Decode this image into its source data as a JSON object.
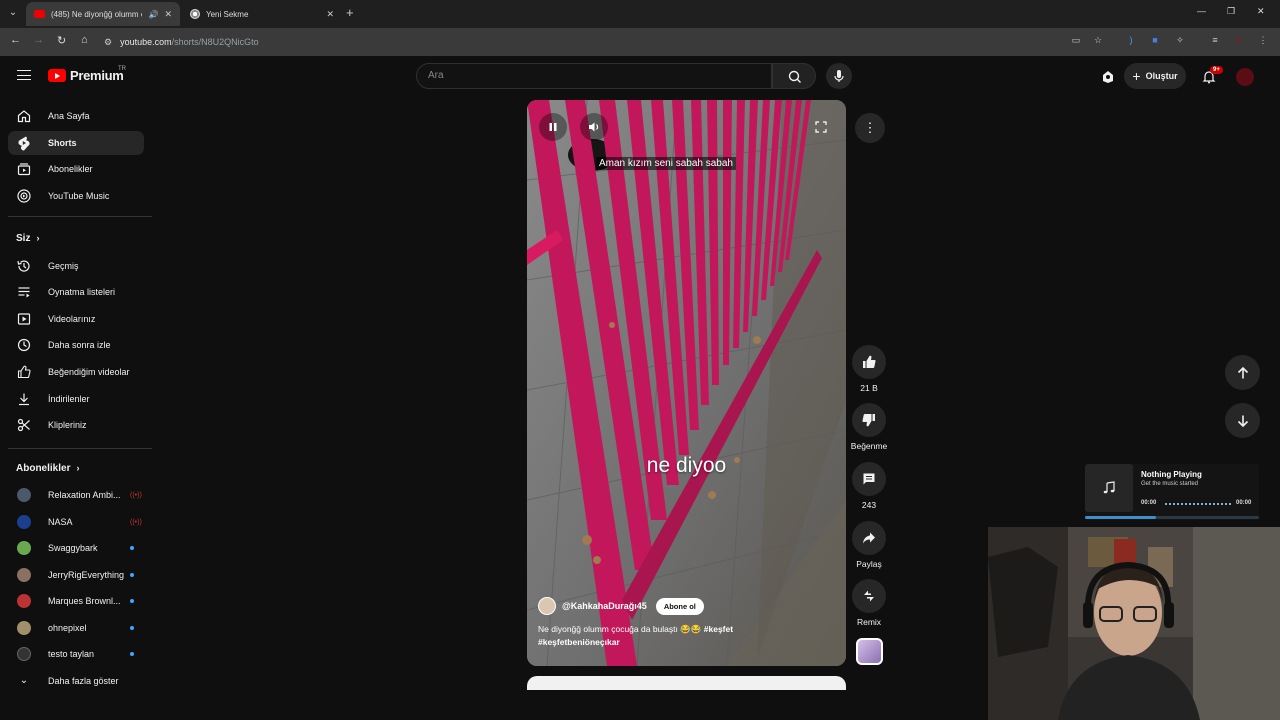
{
  "browser": {
    "tabs": [
      {
        "title": "(485) Ne diyonğğ olumm ç",
        "active": true
      },
      {
        "title": "Yeni Sekme",
        "active": false
      }
    ],
    "url_host": "youtube.com",
    "url_path": "/shorts/N8U2QNicGto"
  },
  "header": {
    "logo_text": "Premium",
    "region": "TR",
    "search_placeholder": "Ara",
    "create_label": "Oluştur",
    "notification_count": "9+"
  },
  "sidebar": {
    "main": [
      {
        "label": "Ana Sayfa",
        "icon": "home-icon"
      },
      {
        "label": "Shorts",
        "icon": "shorts-icon",
        "active": true
      },
      {
        "label": "Abonelikler",
        "icon": "subscriptions-icon"
      },
      {
        "label": "YouTube Music",
        "icon": "youtube-music-icon"
      }
    ],
    "you_heading": "Siz",
    "you": [
      {
        "label": "Geçmiş",
        "icon": "history-icon"
      },
      {
        "label": "Oynatma listeleri",
        "icon": "playlists-icon"
      },
      {
        "label": "Videolarınız",
        "icon": "your-videos-icon"
      },
      {
        "label": "Daha sonra izle",
        "icon": "watch-later-icon"
      },
      {
        "label": "Beğendiğim videolar",
        "icon": "liked-videos-icon"
      },
      {
        "label": "İndirilenler",
        "icon": "downloads-icon"
      },
      {
        "label": "Klipleriniz",
        "icon": "clips-icon"
      }
    ],
    "subs_heading": "Abonelikler",
    "subscriptions": [
      {
        "label": "Relaxation Ambi...",
        "color": "#4a5a6a",
        "status": "live"
      },
      {
        "label": "NASA",
        "color": "#1b3f8f",
        "status": "live"
      },
      {
        "label": "Swaggybark",
        "color": "#6aa84f",
        "status": "new"
      },
      {
        "label": "JerryRigEverything",
        "color": "#8a7060",
        "status": "new"
      },
      {
        "label": "Marques Brownl...",
        "color": "#b33",
        "status": "new"
      },
      {
        "label": "ohnepixel",
        "color": "#a0906a",
        "status": "new"
      },
      {
        "label": "testo taylan",
        "color": "#333",
        "status": "new"
      }
    ],
    "show_more": "Daha fazla göster"
  },
  "short": {
    "caption": "Aman kızım seni sabah sabah",
    "overlay_text": "ne diyoo",
    "channel": "@KahkahaDurağı45",
    "subscribe_label": "Abone ol",
    "description": "Ne diyonğğ olumm çocuğa da bulaştı 😂😂",
    "hashtag1": "#keşfet",
    "hashtag2": "#keşfetbeniöneçıkar"
  },
  "actions": {
    "likes": "21 B",
    "dislike_label": "Beğenme",
    "comments": "243",
    "share_label": "Paylaş",
    "remix_label": "Remix"
  },
  "now_playing": {
    "title": "Nothing Playing",
    "subtitle": "Get the music started",
    "time_start": "00:00",
    "time_end": "00:00",
    "progress": 0.41
  },
  "colors": {
    "background": "#0f0f0f",
    "accent_red": "#ff0000",
    "railing_pink": "#c2185b"
  }
}
